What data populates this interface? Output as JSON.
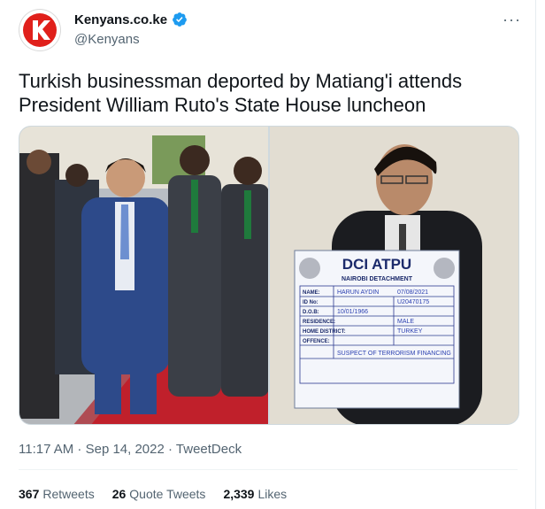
{
  "author": {
    "display_name": "Kenyans.co.ke",
    "handle": "@Kenyans",
    "avatar_icon": "kenyans-k-logo",
    "verified_icon": "verified-badge-icon"
  },
  "menu": {
    "more_label": "···"
  },
  "tweet": {
    "text": "Turkish businessman deported by Matiang'i attends President William Ruto's State House luncheon",
    "timestamp": "11:17 AM · Sep 14, 2022 · TweetDeck"
  },
  "media": {
    "board": {
      "title": "DCI ATPU",
      "subtitle": "NAIROBI DETACHMENT",
      "name_value": "HARUN   AYDIN",
      "date_value": "07/08/2021",
      "pp_value": "U20470175",
      "dob_value": "10/01/1966",
      "gender_value": "MALE",
      "nationality_value": "TURKEY",
      "offence_value": "SUSPECT OF TERRORISM FINANCING"
    }
  },
  "stats": {
    "retweets_count": "367",
    "retweets_label": "Retweets",
    "quotes_count": "26",
    "quotes_label": "Quote Tweets",
    "likes_count": "2,339",
    "likes_label": "Likes"
  },
  "colors": {
    "brand_red": "#e0201b",
    "verified_blue": "#1d9bf0",
    "secondary_text": "#536471"
  }
}
